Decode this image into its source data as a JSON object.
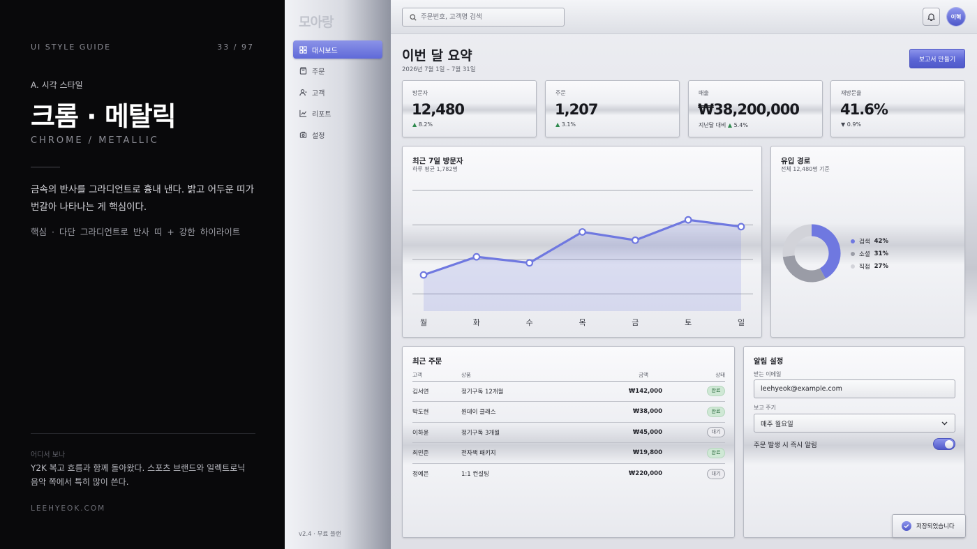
{
  "guide": {
    "label": "UI STYLE GUIDE",
    "page": "33 / 97",
    "section": "A. 시각 스타일",
    "title": "크롬 · 메탈릭",
    "subtitle": "CHROME / METALLIC",
    "description": "금속의 반사를 그라디언트로 흉내 낸다. 밝고 어두운 띠가 번갈아 나타나는 게 핵심이다.",
    "core": "핵심 · 다단 그라디언트로 반사 띠 + 강한 하이라이트",
    "where_label": "어디서 보나",
    "where_text": "Y2K 복고 흐름과 함께 돌아왔다. 스포츠 브랜드와 일렉트로닉 음악 쪽에서 특히 많이 쓴다.",
    "site": "LEEHYEOK.COM"
  },
  "sidebar": {
    "brand": "모아랑",
    "items": [
      {
        "label": "대시보드",
        "icon": "grid-icon",
        "active": true
      },
      {
        "label": "주문",
        "icon": "bag-icon",
        "active": false
      },
      {
        "label": "고객",
        "icon": "user-icon",
        "active": false
      },
      {
        "label": "리포트",
        "icon": "chart-icon",
        "active": false
      },
      {
        "label": "설정",
        "icon": "gear-icon",
        "active": false
      }
    ],
    "version": "v2.4 · 무료 플랜"
  },
  "topbar": {
    "search_placeholder": "주문번호, 고객명 검색",
    "avatar_text": "이혁"
  },
  "header": {
    "title": "이번 달 요약",
    "date_range": "2026년 7월 1일 – 7월 31일",
    "report_button": "보고서 만들기"
  },
  "kpis": [
    {
      "label": "방문자",
      "value": "12,480",
      "prefix": "",
      "delta": "8.2%",
      "direction": "up"
    },
    {
      "label": "주문",
      "value": "1,207",
      "prefix": "",
      "delta": "3.1%",
      "direction": "up"
    },
    {
      "label": "매출",
      "value": "₩38,200,000",
      "prefix": "지난달 대비",
      "delta": "5.4%",
      "direction": "up"
    },
    {
      "label": "재방문율",
      "value": "41.6%",
      "prefix": "",
      "delta": "0.9%",
      "direction": "down"
    }
  ],
  "visitors_card": {
    "title": "최근 7일 방문자",
    "subtitle": "하루 평균 1,782명"
  },
  "traffic_card": {
    "title": "유입 경로",
    "subtitle": "전체 12,480명 기준"
  },
  "chart_data": [
    {
      "type": "area",
      "title": "최근 7일 방문자",
      "categories": [
        "월",
        "화",
        "수",
        "목",
        "금",
        "토",
        "일"
      ],
      "values": [
        1380,
        1620,
        1540,
        1950,
        1840,
        2110,
        2020
      ],
      "ylim": [
        900,
        2500
      ],
      "grid": true,
      "color": "#6f78e0"
    },
    {
      "type": "pie",
      "title": "유입 경로",
      "labels": [
        "검색",
        "소셜",
        "직접"
      ],
      "values": [
        42,
        31,
        27
      ],
      "colors": [
        "#6f78e0",
        "#9a9ca6",
        "#d2d3d9"
      ],
      "legend": "right"
    }
  ],
  "orders": {
    "title": "최근 주문",
    "columns": [
      "고객",
      "상품",
      "금액",
      "상태"
    ],
    "rows": [
      {
        "customer": "김서연",
        "product": "정기구독 12개월",
        "amount": "₩142,000",
        "status": "완료",
        "state": "done"
      },
      {
        "customer": "박도현",
        "product": "원데이 클래스",
        "amount": "₩38,000",
        "status": "완료",
        "state": "done"
      },
      {
        "customer": "이하윤",
        "product": "정기구독 3개월",
        "amount": "₩45,000",
        "status": "대기",
        "state": "wait"
      },
      {
        "customer": "최민준",
        "product": "전자책 패키지",
        "amount": "₩19,800",
        "status": "완료",
        "state": "done"
      },
      {
        "customer": "정예은",
        "product": "1:1 컨설팅",
        "amount": "₩220,000",
        "status": "대기",
        "state": "wait"
      }
    ]
  },
  "alerts": {
    "title": "알림 설정",
    "email_label": "받는 이메일",
    "email_value": "leehyeok@example.com",
    "cycle_label": "보고 주기",
    "cycle_value": "매주 월요일",
    "toggle_label": "주문 발생 시 즉시 알림",
    "toggle_on": true
  },
  "toast": {
    "text": "저장되었습니다"
  }
}
